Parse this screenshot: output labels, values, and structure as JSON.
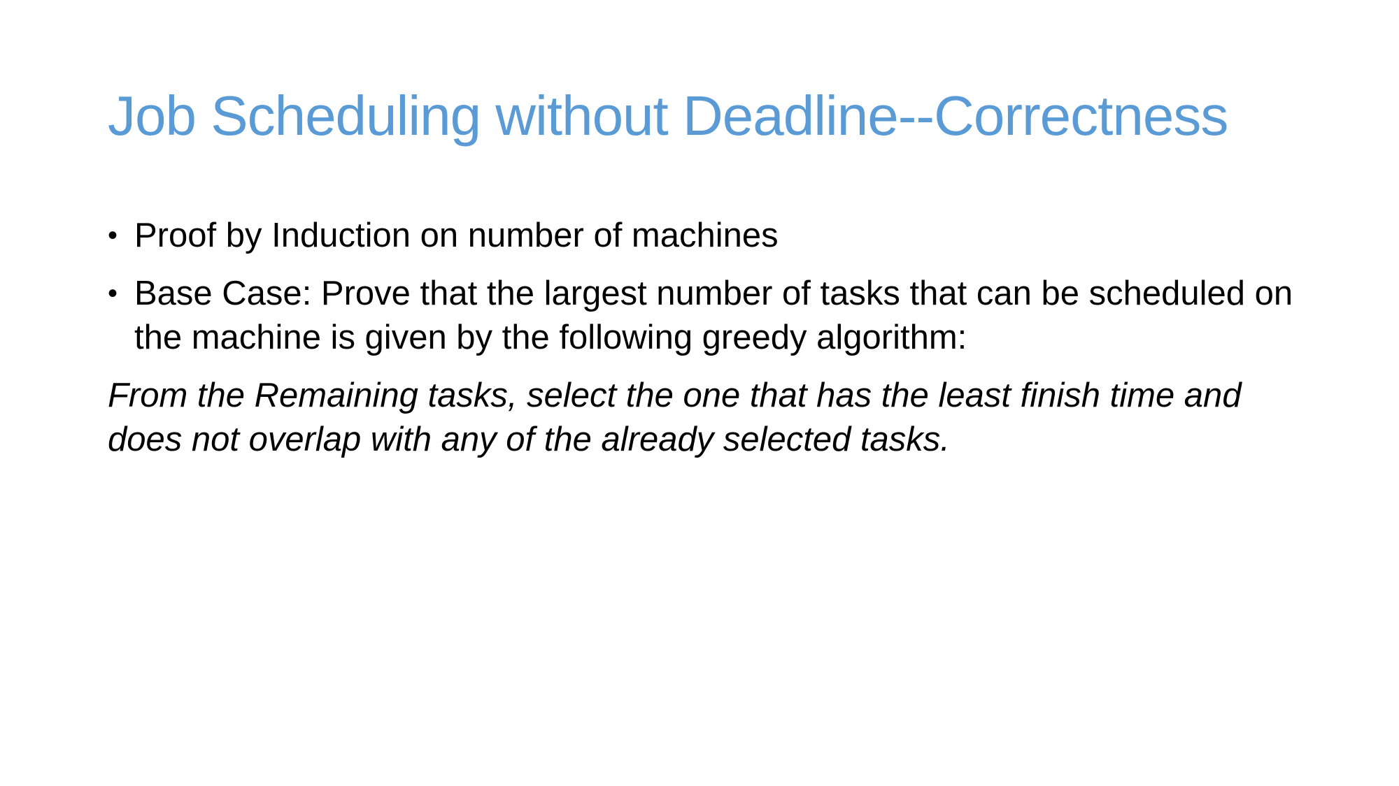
{
  "slide": {
    "title": "Job Scheduling without Deadline--Correctness",
    "bullets": [
      {
        "text": "Proof by Induction on number of machines"
      },
      {
        "text": "Base Case: Prove that the largest number of tasks that can be scheduled on the machine is given by the following greedy algorithm:"
      }
    ],
    "bullet_glyph": "•",
    "italic_paragraph": "From the Remaining tasks, select the one that has the least finish time and does not overlap with any of the already selected tasks.",
    "colors": {
      "title": "#5b9bd5",
      "body": "#000000",
      "background": "#ffffff"
    }
  }
}
